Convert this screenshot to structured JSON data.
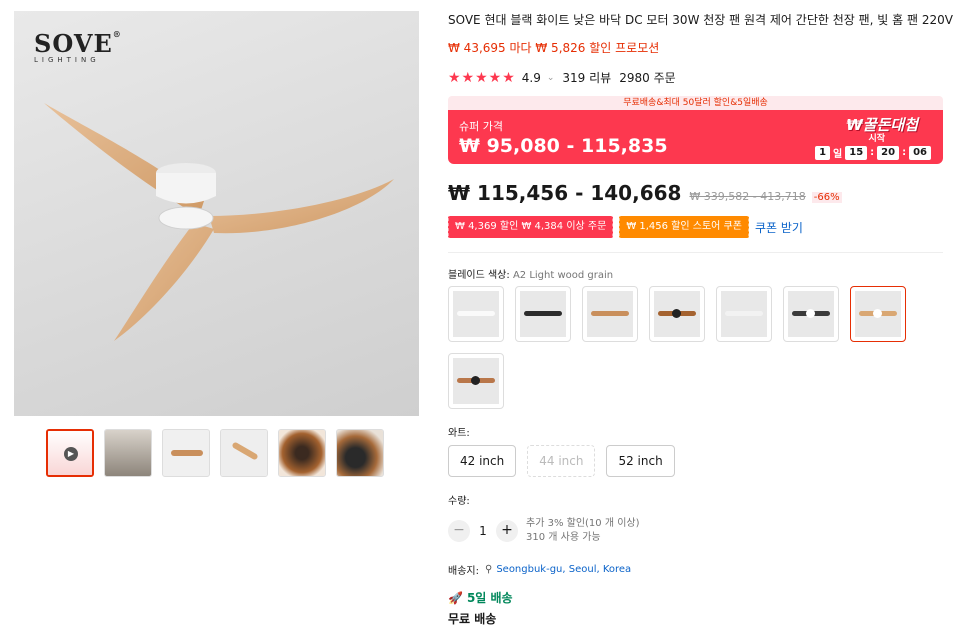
{
  "gallery": {
    "brand_name": "SOVE",
    "brand_reg": "®",
    "brand_sub": "LIGHTING",
    "thumb_count": 6
  },
  "product": {
    "title": "SOVE 현대 블랙 화이트 낮은 바닥 DC 모터 30W 천장 팬 원격 제어 간단한 천장 팬, 빛 홈 팬 220V",
    "promo_line": "₩ 43,695 마다 ₩ 5,826 할인 프로모션",
    "rating": "4.9",
    "rating_chevron": "⌄",
    "reviews": "319 리뷰",
    "orders": "2980 주문"
  },
  "banner": {
    "top_text": "무료배송&최대 50달러 할인&5일배송",
    "label": "슈퍼 가격",
    "price": "₩ 95,080 - 115,835",
    "logo": "₩꿀돈대첩",
    "start": "시작",
    "countdown": {
      "days": "1",
      "day_unit": "일",
      "hours": "15",
      "minutes": "20",
      "seconds": "06"
    }
  },
  "pricing": {
    "current": "₩ 115,456 - 140,668",
    "original": "₩ 339,582 - 413,718",
    "discount": "-66%"
  },
  "coupons": {
    "coupon1": "₩ 4,369 할인 ₩ 4,384 이상 주문",
    "coupon2": "₩ 1,456 할인 스토어 쿠폰",
    "link": "쿠폰 받기"
  },
  "blade": {
    "label": "블레이드 색상: ",
    "value": "A2 Light wood grain",
    "selected_index": 6
  },
  "watt": {
    "label": "와트:",
    "options": [
      "42 inch",
      "44 inch",
      "52 inch"
    ],
    "disabled_index": 1
  },
  "quantity": {
    "label": "수량:",
    "minus": "−",
    "value": "1",
    "plus": "+",
    "discount_note": "추가 3% 할인(10 개 이상)",
    "available": "310 개 사용 가능"
  },
  "shipping": {
    "label": "배송지:",
    "location": "Seongbuk-gu, Seoul, Korea",
    "fast": "5일 배송",
    "free": "무료 배송"
  },
  "colors": {
    "accent": "#fd384f",
    "price_red": "#e62e04",
    "link_blue": "#0b63c9",
    "fast_green": "#00875a",
    "coupon_orange": "#ff8a00",
    "blade_wood": "#d9a773"
  }
}
